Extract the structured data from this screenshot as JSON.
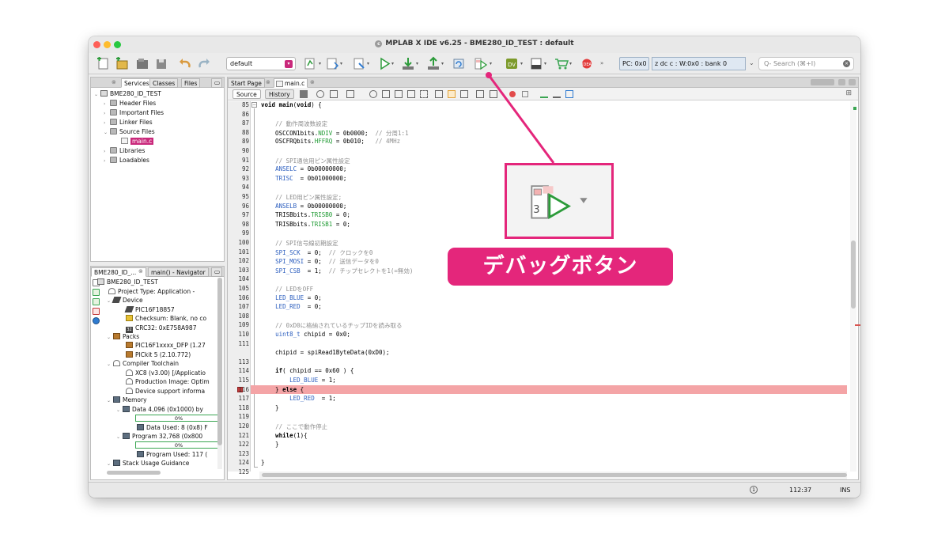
{
  "window": {
    "title": "MPLAB X IDE v6.25 - BME280_ID_TEST : default"
  },
  "toolbar": {
    "config": "default",
    "pc": "PC: 0x0",
    "status": "z dc c  : W:0x0 : bank 0",
    "search_placeholder": "Q- Search (⌘+I)"
  },
  "projects_panel": {
    "tabs": [
      "Services",
      "Classes",
      "Files"
    ],
    "items": [
      {
        "label": "BME280_ID_TEST",
        "icon": "project-icon"
      },
      {
        "label": "Header Files",
        "icon": "folder-icon"
      },
      {
        "label": "Important Files",
        "icon": "folder-icon"
      },
      {
        "label": "Linker Files",
        "icon": "folder-icon"
      },
      {
        "label": "Source Files",
        "icon": "folder-icon"
      },
      {
        "label": "main.c",
        "icon": "c-file-icon"
      },
      {
        "label": "Libraries",
        "icon": "folder-icon"
      },
      {
        "label": "Loadables",
        "icon": "folder-icon"
      }
    ]
  },
  "dashboard_panel": {
    "tabs": [
      "BME280_ID_...",
      "main() - Navigator"
    ],
    "items": [
      {
        "label": "BME280_ID_TEST"
      },
      {
        "label": "Project Type: Application -"
      },
      {
        "label": "Device"
      },
      {
        "label": "PIC16F18857"
      },
      {
        "label": "Checksum: Blank, no co"
      },
      {
        "label": "CRC32: 0xE758A987"
      },
      {
        "label": "Packs"
      },
      {
        "label": "PIC16F1xxxx_DFP (1.27"
      },
      {
        "label": "PICkit 5 (2.10.772)"
      },
      {
        "label": "Compiler Toolchain"
      },
      {
        "label": "XC8 (v3.00) [/Applicatio"
      },
      {
        "label": "Production Image: Optim"
      },
      {
        "label": "Device support informa"
      },
      {
        "label": "Memory"
      },
      {
        "label": "Data 4,096 (0x1000) by"
      },
      {
        "label": "Data Used: 8 (0x8) F"
      },
      {
        "label": "Program 32,768 (0x800"
      },
      {
        "label": "Program Used: 117 ("
      },
      {
        "label": "Stack Usage Guidance"
      }
    ],
    "data_progress": "0%",
    "program_progress": "0%"
  },
  "editor": {
    "tabs": [
      "Start Page",
      "main.c"
    ],
    "source_button": "Source",
    "history_button": "History",
    "lines": [
      {
        "no": "85",
        "text": "void main(void) {"
      },
      {
        "no": "86",
        "text": ""
      },
      {
        "no": "87",
        "text": "    // 動作周波数設定"
      },
      {
        "no": "88",
        "text": "    OSCCON1bits.NDIV = 0b0000;  // 分周1:1"
      },
      {
        "no": "89",
        "text": "    OSCFRQbits.HFFRQ = 0b010;   // 4MHz"
      },
      {
        "no": "90",
        "text": ""
      },
      {
        "no": "91",
        "text": "    // SPI通信用ピン属性設定"
      },
      {
        "no": "92",
        "text": "    ANSELC = 0b00000000;"
      },
      {
        "no": "93",
        "text": "    TRISC  = 0b01000000;"
      },
      {
        "no": "94",
        "text": ""
      },
      {
        "no": "95",
        "text": "    // LED用ピン属性設定;"
      },
      {
        "no": "96",
        "text": "    ANSELB = 0b00000000;"
      },
      {
        "no": "97",
        "text": "    TRISBbits.TRISB0 = 0;"
      },
      {
        "no": "98",
        "text": "    TRISBbits.TRISB1 = 0;"
      },
      {
        "no": "99",
        "text": ""
      },
      {
        "no": "100",
        "text": "    // SPI信号線初期設定"
      },
      {
        "no": "101",
        "text": "    SPI_SCK  = 0;  // クロックを0"
      },
      {
        "no": "102",
        "text": "    SPI_MOSI = 0;  // 送信データを0"
      },
      {
        "no": "103",
        "text": "    SPI_CSB  = 1;  // チップセレクトを1(=無効)"
      },
      {
        "no": "104",
        "text": ""
      },
      {
        "no": "105",
        "text": "    // LEDをOFF"
      },
      {
        "no": "106",
        "text": "    LED_BLUE = 0;"
      },
      {
        "no": "107",
        "text": "    LED_RED  = 0;"
      },
      {
        "no": "108",
        "text": ""
      },
      {
        "no": "109",
        "text": "    // 0xD0に格納されているチップIDを読み取る"
      },
      {
        "no": "110",
        "text": "    uint8_t chipid = 0x0;"
      },
      {
        "no": "111",
        "text": ""
      },
      {
        "no": "",
        "text": "    chipid = spiRead1ByteData(0xD0);"
      },
      {
        "no": "113",
        "text": ""
      },
      {
        "no": "114",
        "text": "    if( chipid == 0x60 ) {"
      },
      {
        "no": "115",
        "text": "        LED_BLUE = 1;"
      },
      {
        "no": "116",
        "text": "    } else {"
      },
      {
        "no": "117",
        "text": "        LED_RED  = 1;"
      },
      {
        "no": "118",
        "text": "    }"
      },
      {
        "no": "119",
        "text": ""
      },
      {
        "no": "120",
        "text": "    // ここで動作停止"
      },
      {
        "no": "121",
        "text": "    while(1){"
      },
      {
        "no": "122",
        "text": "    }"
      },
      {
        "no": "123",
        "text": ""
      },
      {
        "no": "124",
        "text": "}"
      },
      {
        "no": "125",
        "text": ""
      }
    ]
  },
  "statusbar": {
    "position": "112:37",
    "mode": "INS"
  },
  "callout": {
    "label": "デバッグボタン",
    "color": "#e4267b"
  }
}
